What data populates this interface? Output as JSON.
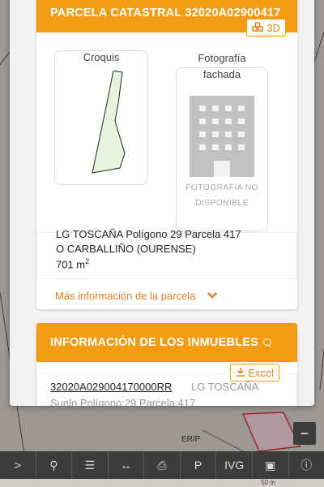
{
  "parcel": {
    "header": "PARCELA CATASTRAL 32020A02900417",
    "btn_3d": "3D",
    "croquis_label": "Croquis",
    "foto_label_1": "Fotografía",
    "foto_label_2": "fachada",
    "no_photo_1": "FOTOGRAFÍA NO",
    "no_photo_2": "DISPONIBLE",
    "address_line1": "LG TOSCAÑA Polígono 29 Parcela 417",
    "address_line2": "O CARBALLIÑO (OURENSE)",
    "area_value": "701 m",
    "area_sup": "2",
    "more_info": "Más información de la parcela"
  },
  "inmuebles": {
    "header": "INFORMACIÓN DE LOS INMUEBLES",
    "excel": "Excel",
    "ref": "32020A029004170000RR",
    "loc": "LG TOSCAÑA",
    "sub": "Suelo Polígono:29 Parcela:417"
  },
  "map": {
    "label_erp": "ER/P",
    "scale": "50 m"
  },
  "toolbar": {
    "items": [
      ">",
      "search",
      "layers",
      "measure",
      "print",
      "P",
      "IVG",
      "3d",
      "info"
    ]
  },
  "colors": {
    "accent": "#f39c12",
    "accent_text": "#e67e22"
  }
}
